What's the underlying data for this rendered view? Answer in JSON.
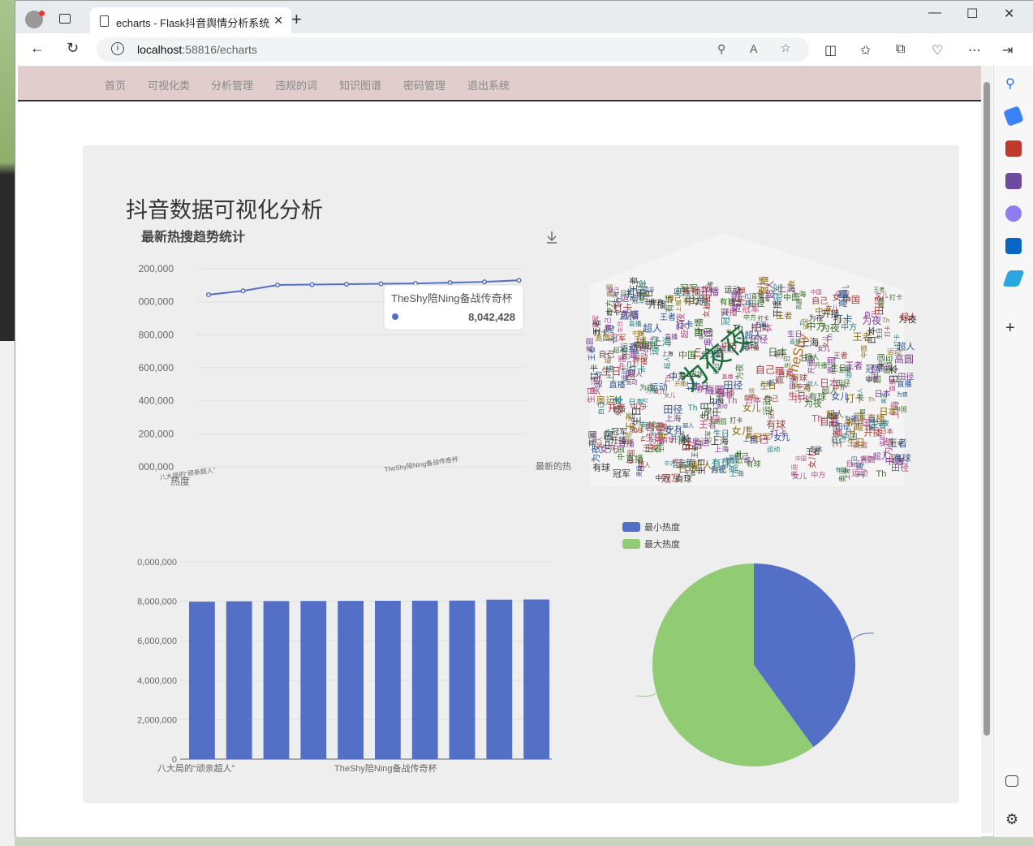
{
  "browser": {
    "tab_title": "echarts - Flask抖音舆情分析系统",
    "url_host": "localhost",
    "url_rest": ":58816/echarts"
  },
  "nav": [
    "首页",
    "可视化类",
    "分析管理",
    "违规的词",
    "知识图谱",
    "密码管理",
    "退出系统"
  ],
  "page": {
    "title": "抖音数据可视化分析"
  },
  "chart_data": [
    {
      "type": "line",
      "title": "最新热搜趋势统计",
      "xlabel": "最新的热",
      "ylabel": "热度",
      "ylim": [
        0,
        10200000
      ],
      "yticks": [
        "000,000",
        "200,000",
        "400,000",
        "600,000",
        "800,000",
        "000,000",
        "200,000"
      ],
      "x": [
        "八大局的“顽亲超人”",
        "",
        "",
        "",
        "",
        "",
        "",
        "",
        "",
        "TheShy陪Ning备战传奇杯"
      ],
      "values": [
        9750000,
        9850000,
        10000000,
        10010000,
        10020000,
        10030000,
        10040000,
        10060000,
        10080000,
        10120000
      ],
      "tooltip": {
        "label": "TheShy陪Ning备战传奇杯",
        "value": "8,042,428"
      }
    },
    {
      "type": "bar",
      "categories": [
        "八大局的“顽亲超人”",
        "",
        "",
        "",
        "",
        "TheShy陪Ning备战传奇杯",
        "",
        "",
        "",
        ""
      ],
      "values": [
        7980000,
        8000000,
        8010000,
        8015000,
        8020000,
        8025000,
        8030000,
        8035000,
        8080000,
        8090000
      ],
      "ylim": [
        0,
        10000000
      ],
      "yticks": [
        "0",
        "2,000,000",
        "4,000,000",
        "6,000,000",
        "8,000,000",
        "0,000,000"
      ],
      "color": "#5470c6"
    },
    {
      "type": "pie",
      "series": [
        {
          "name": "最小热度",
          "value": 40,
          "color": "#5470c6"
        },
        {
          "name": "最大热度",
          "value": 60,
          "color": "#91cc75"
        }
      ]
    },
    {
      "type": "wordcloud",
      "words": [
        "为夜夜",
        "TheShy",
        "自己",
        "上海",
        "中国航天",
        "开播",
        "女儿",
        "直播",
        "运动会",
        "冠军",
        "超人",
        "王者",
        "中方",
        "有球",
        "高圆圆",
        "生日",
        "奥运",
        "田径",
        "打卡",
        "日本"
      ]
    }
  ]
}
